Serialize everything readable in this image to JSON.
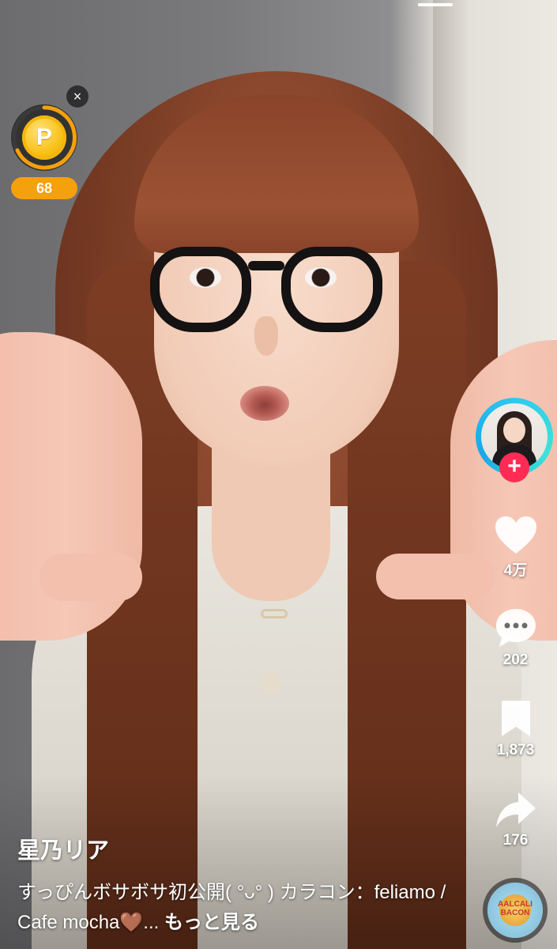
{
  "coin_widget": {
    "close_icon": "×",
    "coin_letter": "P",
    "coin_count": "68",
    "coin_color": "#f9c21a",
    "badge_color": "#f5a00d"
  },
  "creator": {
    "follow_icon": "+",
    "follow_color": "#fe2c55",
    "ring_color": "#2ec9f0"
  },
  "actions": {
    "like_count": "4万",
    "comment_count": "202",
    "save_count": "1,873",
    "share_count": "176",
    "icons": [
      "heart-icon",
      "comment-icon",
      "bookmark-icon",
      "share-icon",
      "music-disc-icon"
    ]
  },
  "music_disc": {
    "disc_text_line1": "AALCALI",
    "disc_text_line2": "BACON"
  },
  "caption": {
    "username": "星乃リア",
    "description": "すっぴんボサボサ初公開( °ᴗ° ) カラコン：feliamo / Cafe mocha🤎... ",
    "see_more": "もっと見る"
  }
}
